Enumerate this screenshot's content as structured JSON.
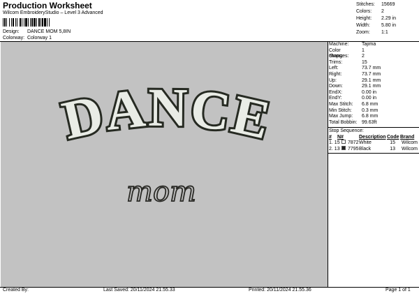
{
  "header": {
    "title": "Production Worksheet",
    "subtitle": "Wilcom EmbroideryStudio – Level 3 Advanced"
  },
  "design": {
    "label": "Design:",
    "value": "DANCE MOM 5,8IN"
  },
  "colorway": {
    "label": "Colorway:",
    "value": "Colorway 1"
  },
  "stats": [
    {
      "label": "Stitches:",
      "value": "15669"
    },
    {
      "label": "Colors:",
      "value": "2"
    },
    {
      "label": "Height:",
      "value": "2.29 in"
    },
    {
      "label": "Width:",
      "value": "5.80 in"
    },
    {
      "label": "Zoom:",
      "value": "1:1"
    }
  ],
  "artwork": {
    "main_text": "DANCE",
    "script_text": "mom"
  },
  "machine_info": [
    {
      "label": "Machine:",
      "value": "Tajima"
    },
    {
      "label": "Color changes:",
      "value": "1"
    },
    {
      "label": "Stops:",
      "value": "2"
    },
    {
      "label": "Trims:",
      "value": "15"
    },
    {
      "label": "Left:",
      "value": "73.7 mm"
    },
    {
      "label": "Right:",
      "value": "73.7 mm"
    },
    {
      "label": "Up:",
      "value": "29.1 mm"
    },
    {
      "label": "Down:",
      "value": "29.1 mm"
    },
    {
      "label": "EndX:",
      "value": "0.00 in"
    },
    {
      "label": "EndY:",
      "value": "0.00 in"
    },
    {
      "label": "Max Stitch:",
      "value": "6.8 mm"
    },
    {
      "label": "Min Stitch:",
      "value": "0.3 mm"
    },
    {
      "label": "Max Jump:",
      "value": "6.8 mm"
    },
    {
      "label": "Total Bobbin:",
      "value": "99.63ft"
    }
  ],
  "stop_sequence": {
    "title": "Stop Sequence:",
    "headers": [
      "#",
      "N#",
      "Description",
      "Code",
      "Brand"
    ],
    "rows": [
      {
        "index": "1.",
        "needle": "15",
        "code": "7872",
        "description": "White",
        "code_col": "15",
        "brand": "Wilcom",
        "color": "#ffffff"
      },
      {
        "index": "2.",
        "needle": "13",
        "code": "7795",
        "description": "Black",
        "code_col": "13",
        "brand": "Wilcom",
        "color": "#222222"
      }
    ]
  },
  "footer": {
    "created_by": "Created By:",
    "last_saved": "Last Saved: 20/11/2024 21.55.33",
    "printed": "Printed: 20/11/2024 21.55.36",
    "page": "Page 1 of 1"
  }
}
